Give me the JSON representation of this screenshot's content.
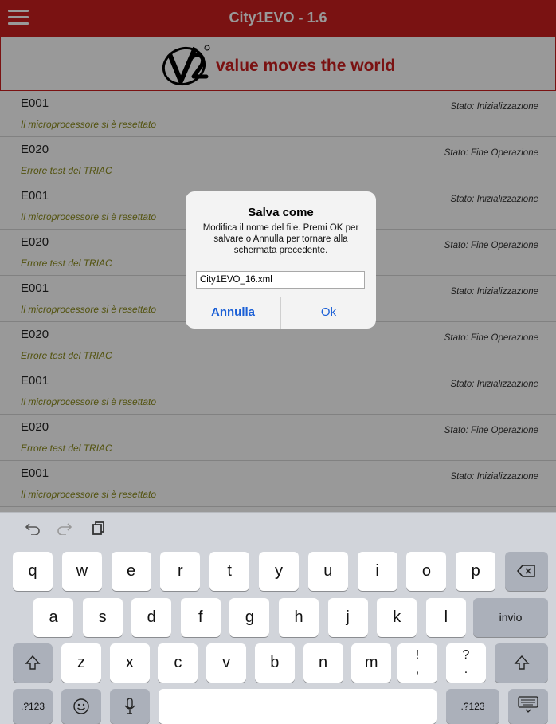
{
  "app": {
    "title": "City1EVO - 1.6"
  },
  "banner": {
    "tagline": "value moves the world"
  },
  "list": {
    "rows": [
      {
        "code": "E001",
        "desc": "Il microprocessore si è resettato",
        "status": "Stato: Inizializzazione"
      },
      {
        "code": "E020",
        "desc": "Errore test del TRIAC",
        "status": "Stato: Fine Operazione"
      },
      {
        "code": "E001",
        "desc": "Il microprocessore si è resettato",
        "status": "Stato: Inizializzazione"
      },
      {
        "code": "E020",
        "desc": "Errore test del TRIAC",
        "status": "Stato: Fine Operazione"
      },
      {
        "code": "E001",
        "desc": "Il microprocessore si è resettato",
        "status": "Stato: Inizializzazione"
      },
      {
        "code": "E020",
        "desc": "Errore test del TRIAC",
        "status": "Stato: Fine Operazione"
      },
      {
        "code": "E001",
        "desc": "Il microprocessore si è resettato",
        "status": "Stato: Inizializzazione"
      },
      {
        "code": "E020",
        "desc": "Errore test del TRIAC",
        "status": "Stato: Fine Operazione"
      },
      {
        "code": "E001",
        "desc": "Il microprocessore si è resettato",
        "status": "Stato: Inizializzazione"
      }
    ]
  },
  "dialog": {
    "title": "Salva come",
    "message": "Modifica il nome del file. Premi OK per salvare o Annulla per tornare alla schermata precedente.",
    "input_value": "City1EVO_16.xml",
    "cancel_label": "Annulla",
    "ok_label": "Ok"
  },
  "keyboard": {
    "row1": [
      "q",
      "w",
      "e",
      "r",
      "t",
      "y",
      "u",
      "i",
      "o",
      "p"
    ],
    "row2": [
      "a",
      "s",
      "d",
      "f",
      "g",
      "h",
      "j",
      "k",
      "l"
    ],
    "row3": [
      "z",
      "x",
      "c",
      "v",
      "b",
      "n",
      "m"
    ],
    "return_label": "invio",
    "numbers_label": ".?123",
    "punct1_top": "!",
    "punct1_bottom": ",",
    "punct2_top": "?",
    "punct2_bottom": ".",
    "icons": [
      "undo-icon",
      "redo-icon",
      "paste-icon",
      "backspace-icon",
      "shift-icon",
      "emoji-icon",
      "microphone-icon",
      "keyboard-dismiss-icon"
    ]
  },
  "colors": {
    "brand_red": "#cc1f1f",
    "link_blue": "#1a5fd6",
    "desc_olive": "#8a8a1a"
  }
}
